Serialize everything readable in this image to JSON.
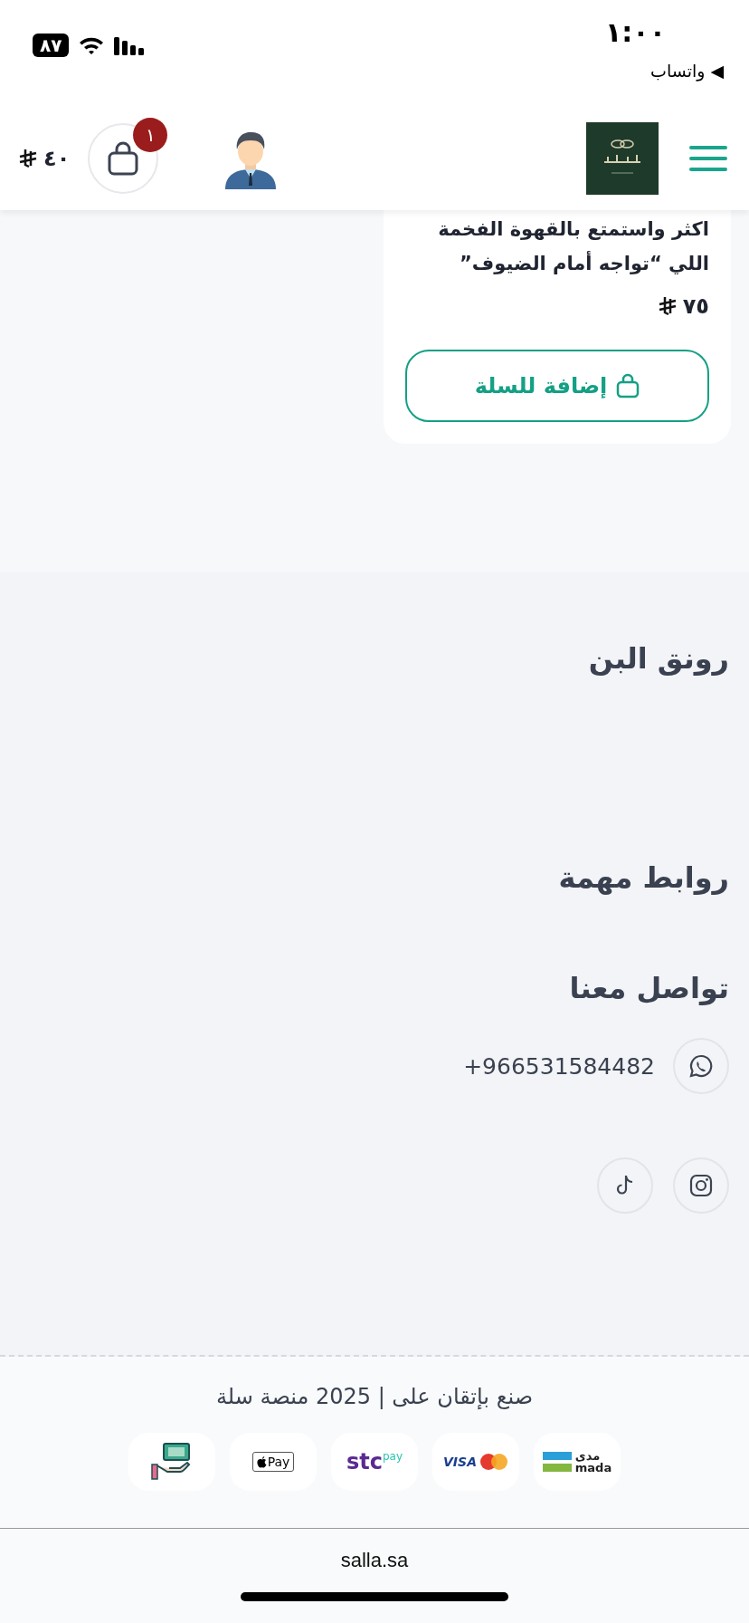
{
  "status_bar": {
    "time": "١:٠٠",
    "back_app": "واتساب",
    "back_arrow": "◀",
    "battery": "٨٧"
  },
  "header": {
    "cart_count": "١",
    "cart_total": "٤٠"
  },
  "product": {
    "description": [
      "اكثر واستمتع بالقهوة الفخمة",
      "اللي “تواجه أمام الضيوف”"
    ],
    "price": "٧٥",
    "add_button": "إضافة للسلة"
  },
  "footer": {
    "store_name": "رونق البن",
    "links_title": "روابط مهمة",
    "contact_title": "تواصل معنا",
    "contacts": [
      {
        "kind": "whatsapp",
        "value": "+966531584482"
      }
    ],
    "socials": [
      {
        "kind": "instagram"
      },
      {
        "kind": "tiktok"
      }
    ],
    "credit": "صنع بإتقان على | 2025 منصة سلة",
    "payments": [
      {
        "kind": "mada",
        "texts": [
          "مدى",
          "mada"
        ]
      },
      {
        "kind": "cards",
        "texts": [
          "VISA"
        ]
      },
      {
        "kind": "stcpay",
        "texts": [
          "stc",
          "pay"
        ]
      },
      {
        "kind": "applepay",
        "texts": [
          "Pay"
        ]
      },
      {
        "kind": "cash"
      }
    ]
  },
  "browser": {
    "url": "salla.sa"
  }
}
